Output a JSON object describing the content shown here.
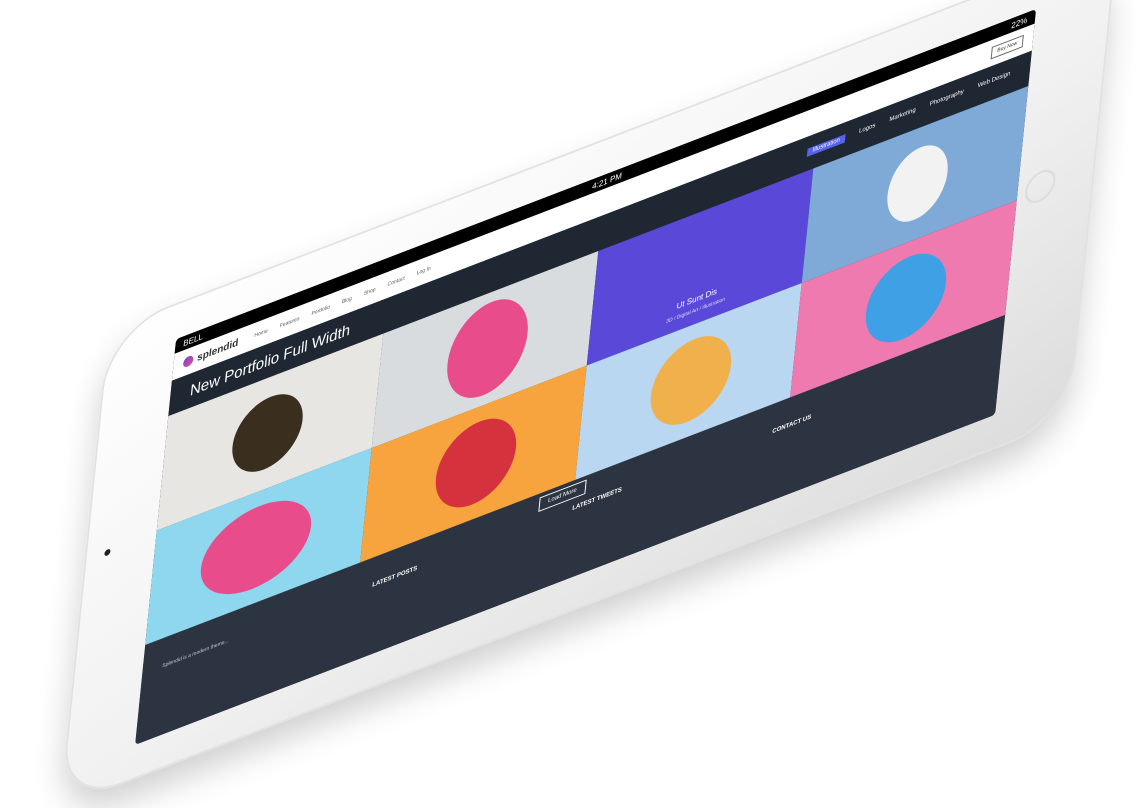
{
  "device": {
    "status": {
      "carrier": "BELL",
      "time": "4:21 PM",
      "battery": "22%"
    }
  },
  "site": {
    "logo": "splendid",
    "nav": [
      "Home",
      "Features",
      "Portfolio",
      "Blog",
      "Shop",
      "Contact",
      "Log In"
    ],
    "header_button": "Buy Now",
    "page_title": "New Portfolio Full Width",
    "filters": [
      "Illustration",
      "Logos",
      "Marketing",
      "Photography",
      "Web Design"
    ],
    "featured_tile": {
      "title": "Ut Sunt Dis",
      "subtitle": "3D / Digital Art / Illustration"
    },
    "load_more": "Load More",
    "footer": {
      "about": "Splendid is a modern theme...",
      "latest_posts_title": "LATEST POSTS",
      "latest_tweets_title": "LATEST TWEETS",
      "contact_title": "CONTACT US"
    }
  },
  "colors": {
    "accent": "#5763e8",
    "dark": "#2b3440"
  }
}
